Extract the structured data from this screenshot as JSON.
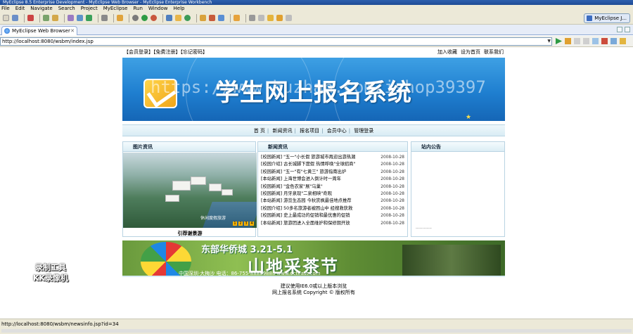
{
  "window": {
    "title": "MyEclipse 8.5 Enterprise Development - MyEclipse Web Browser - MyEclipse Enterprise Workbench"
  },
  "menu": [
    "File",
    "Edit",
    "Navigate",
    "Search",
    "Project",
    "MyEclipse",
    "Run",
    "Window",
    "Help"
  ],
  "perspective": {
    "label": "MyEclipse J..."
  },
  "browser": {
    "tab_label": "MyEclipse Web Browser",
    "url": "http://localhost:8080/wsbm/index.jsp"
  },
  "site": {
    "top_links": "【会员登录】【免费注册】【忘记密码】",
    "top_right": [
      "加入收藏",
      "设为首页",
      "联系我们"
    ],
    "banner_title": "学生网上报名系统",
    "banner_watermark": "https://www.huzhan.com/ishop39397",
    "nav": [
      "首 页",
      "新闻资讯",
      "报名项目",
      "会员中心",
      "管理登录"
    ],
    "panels": {
      "images": "图片资讯",
      "news": "新闻资讯",
      "notice": "站内公告"
    },
    "photo_caption": "引荐谢景游",
    "photo_overlay": "休闲度假旅游",
    "photo_dots": [
      "1",
      "2",
      "3",
      "4"
    ],
    "news": [
      {
        "title": "[校园新闻] \"五一\"小长假 旅游城市再迎出游热潮",
        "date": "2008-10-28"
      },
      {
        "title": "[校园介绍] 古长城脚下度假 热情呼唤\"全球招商\"",
        "date": "2008-10-28"
      },
      {
        "title": "[校园新闻] \"五一\"有\"七黄三\" 旅游指南出炉",
        "date": "2008-10-28"
      },
      {
        "title": "[本站新闻] 上海世博会进入倒计时一周年",
        "date": "2008-10-28"
      },
      {
        "title": "[校园新闻] \"金色农家\"展\"乌巢\"",
        "date": "2008-10-28"
      },
      {
        "title": "[校园新闻] 月牙泉现\"二泉相映\"奇观",
        "date": "2008-10-28"
      },
      {
        "title": "[本站新闻] 游览生态园 今秋赏枫最佳地点推荐",
        "date": "2008-10-28"
      },
      {
        "title": "[校园介绍] 50多名旅游者被困山中 经搜救获救",
        "date": "2008-10-28"
      },
      {
        "title": "[校园新闻] 史上最成功的促销和最优惠的促销",
        "date": "2008-10-28"
      },
      {
        "title": "[本站新闻] 旅游团进入全面维护和保修期开放",
        "date": "2008-10-28"
      }
    ],
    "notice_more": "............",
    "ad": {
      "line1": "东部华侨城 3.21-5.1",
      "line2": "山地采茶节",
      "line3": "中国深圳·大梅沙  电话：86-755-88889888  www.octeast.com"
    },
    "footer_line1": "建议使用IE6.0或以上版本浏览",
    "footer_line2": "网上报名系统 Copyright © 版权所有"
  },
  "overlay": {
    "line1": "录制工具",
    "line2": "KK录像机"
  },
  "status": {
    "text": "http://localhost:8080/wsbm/newsinfo.jsp?id=34"
  }
}
